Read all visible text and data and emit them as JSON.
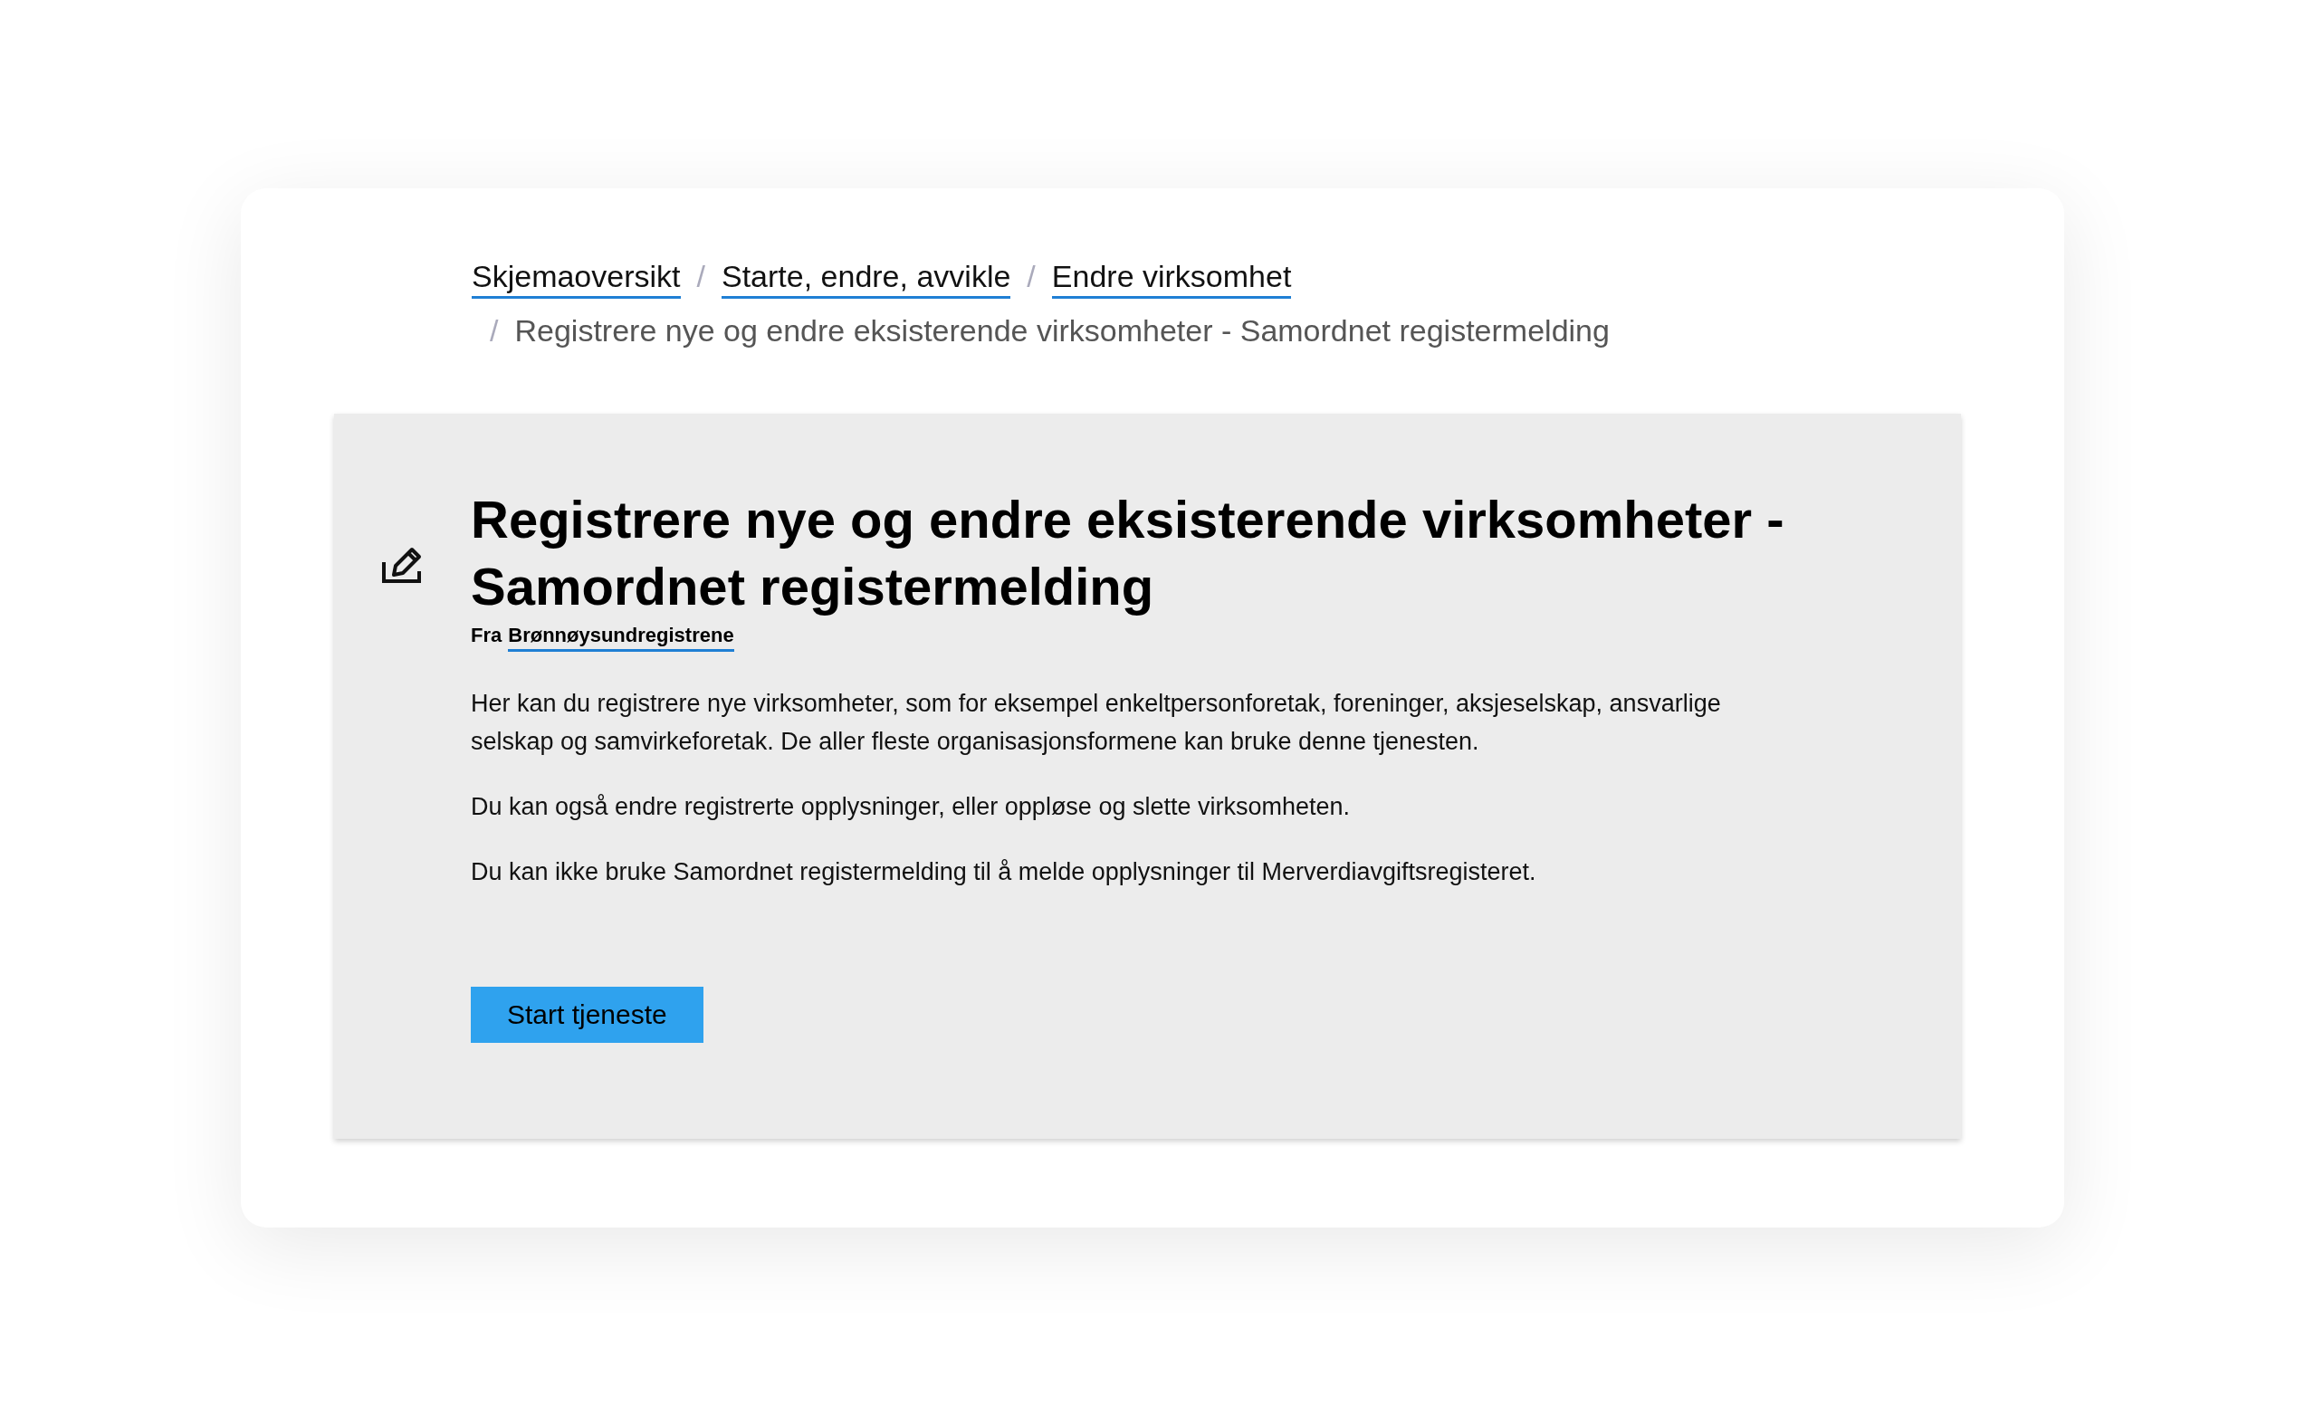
{
  "breadcrumbs": [
    {
      "label": "Skjemaoversikt",
      "link": true
    },
    {
      "separator": "/",
      "label": "Starte, endre, avvikle",
      "link": true
    },
    {
      "separator": "/",
      "label": "Endre virksomhet",
      "link": true
    },
    {
      "separator": "/",
      "label": "Registrere nye og endre eksisterende virksomheter - Samordnet registermelding",
      "link": false
    }
  ],
  "service": {
    "title": "Registrere nye og endre eksisterende virksomheter - Samordnet registermelding",
    "from_label": "Fra",
    "provider": "Brønnøysundregistrene",
    "paragraphs": [
      "Her kan du registrere nye virksomheter, som for eksempel enkeltpersonforetak, foreninger, aksjeselskap, ansvarlige selskap og samvirkeforetak. De aller fleste organisasjonsformene kan bruke denne tjenesten.",
      "Du kan også endre registrerte opplysninger, eller oppløse og slette virksomheten.",
      "Du kan ikke bruke Samordnet registermelding til å melde opplysninger til Merverdiavgiftsregisteret."
    ],
    "button": "Start tjeneste"
  }
}
